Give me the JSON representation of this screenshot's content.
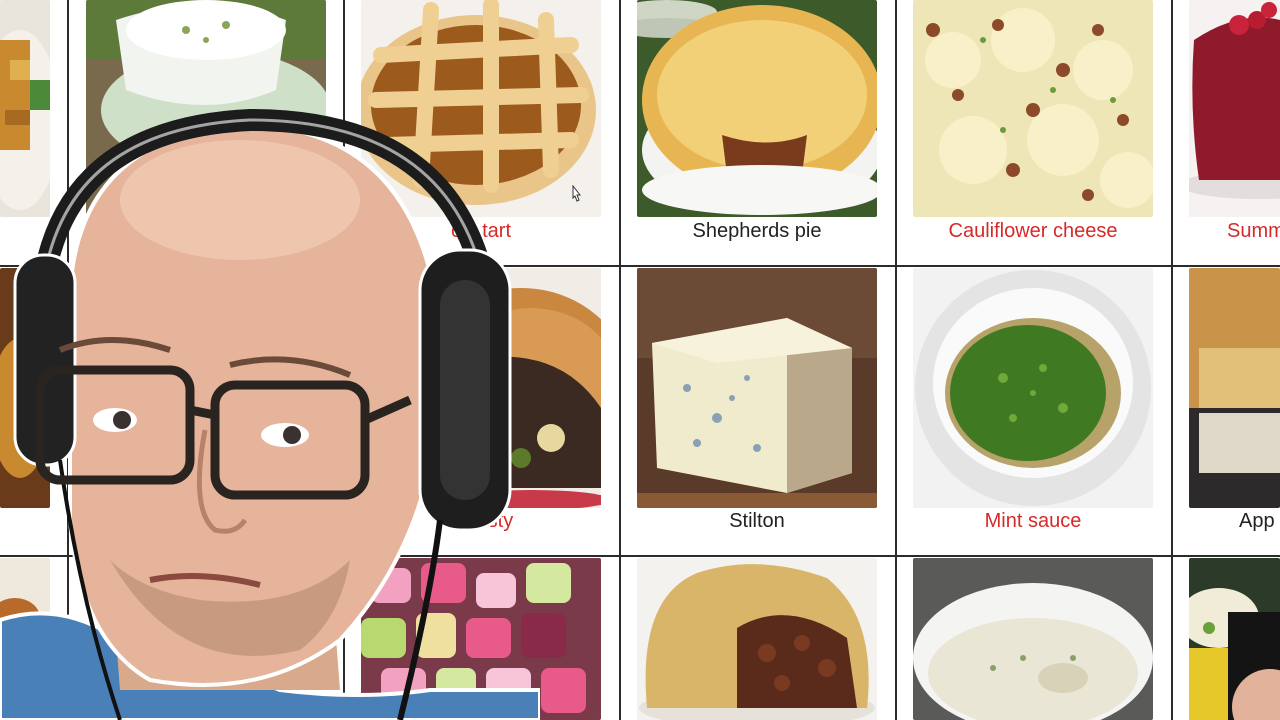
{
  "colors": {
    "link": "#d62a2a",
    "text": "#222222",
    "grid": "#2b2b2b"
  },
  "rows": [
    {
      "cells": [
        {
          "caption": "",
          "style": "plain",
          "thumb": "fries-food-photo"
        },
        {
          "caption": "",
          "style": "plain",
          "thumb": "cream-dessert-photo"
        },
        {
          "caption": "cle tart",
          "style": "link",
          "thumb": "lattice-tart-photo"
        },
        {
          "caption": "Shepherds pie",
          "style": "plain",
          "thumb": "shepherds-pie-photo"
        },
        {
          "caption": "Cauliflower cheese",
          "style": "link",
          "thumb": "cauliflower-cheese-photo"
        },
        {
          "caption": "Summ",
          "style": "link",
          "thumb": "summer-pudding-photo"
        }
      ]
    },
    {
      "cells": [
        {
          "caption": "",
          "style": "plain",
          "thumb": "dish-photo"
        },
        {
          "caption": "",
          "style": "plain",
          "thumb": "blank"
        },
        {
          "caption": "h pasty",
          "style": "link",
          "thumb": "pasty-photo"
        },
        {
          "caption": "Stilton",
          "style": "plain",
          "thumb": "stilton-photo"
        },
        {
          "caption": "Mint sauce",
          "style": "link",
          "thumb": "mint-sauce-photo"
        },
        {
          "caption": "App",
          "style": "plain",
          "thumb": "apple-crumble-photo"
        }
      ]
    },
    {
      "cells": [
        {
          "caption": "",
          "style": "plain",
          "thumb": "dish-photo"
        },
        {
          "caption": "",
          "style": "plain",
          "thumb": "blank"
        },
        {
          "caption": "",
          "style": "plain",
          "thumb": "sweets-photo"
        },
        {
          "caption": "",
          "style": "plain",
          "thumb": "steak-pudding-photo"
        },
        {
          "caption": "",
          "style": "plain",
          "thumb": "soup-photo"
        },
        {
          "caption": "",
          "style": "plain",
          "thumb": "salad-photo"
        }
      ]
    }
  ],
  "icons": {
    "cursor": "mouse-cursor-icon"
  }
}
